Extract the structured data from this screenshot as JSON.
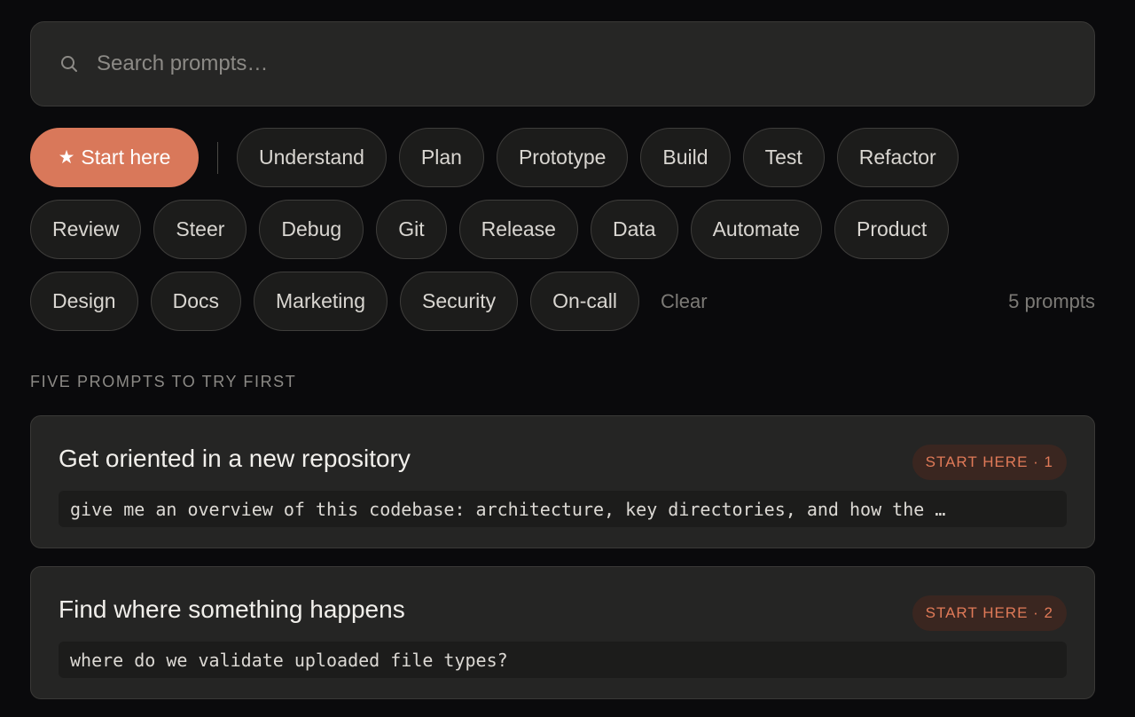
{
  "search": {
    "placeholder": "Search prompts…"
  },
  "filters": {
    "active": "Start here",
    "row1": [
      "Understand",
      "Plan",
      "Prototype",
      "Build",
      "Test",
      "Refactor"
    ],
    "row2": [
      "Review",
      "Steer",
      "Debug",
      "Git",
      "Release",
      "Data",
      "Automate",
      "Product"
    ],
    "row3": [
      "Design",
      "Docs",
      "Marketing",
      "Security",
      "On-call"
    ],
    "clear_label": "Clear",
    "count_label": "5 prompts"
  },
  "section": {
    "label": "FIVE PROMPTS TO TRY FIRST"
  },
  "cards": [
    {
      "title": "Get oriented in a new repository",
      "badge": "START HERE · 1",
      "prompt": "give me an overview of this codebase: architecture, key directories, and how the …"
    },
    {
      "title": "Find where something happens",
      "badge": "START HERE · 2",
      "prompt": "where do we validate uploaded file types?"
    }
  ],
  "colors": {
    "accent": "#d9785a",
    "background": "#0a0a0c",
    "card": "#252524"
  },
  "icons": {
    "search": "search-icon",
    "star": "star-icon"
  }
}
